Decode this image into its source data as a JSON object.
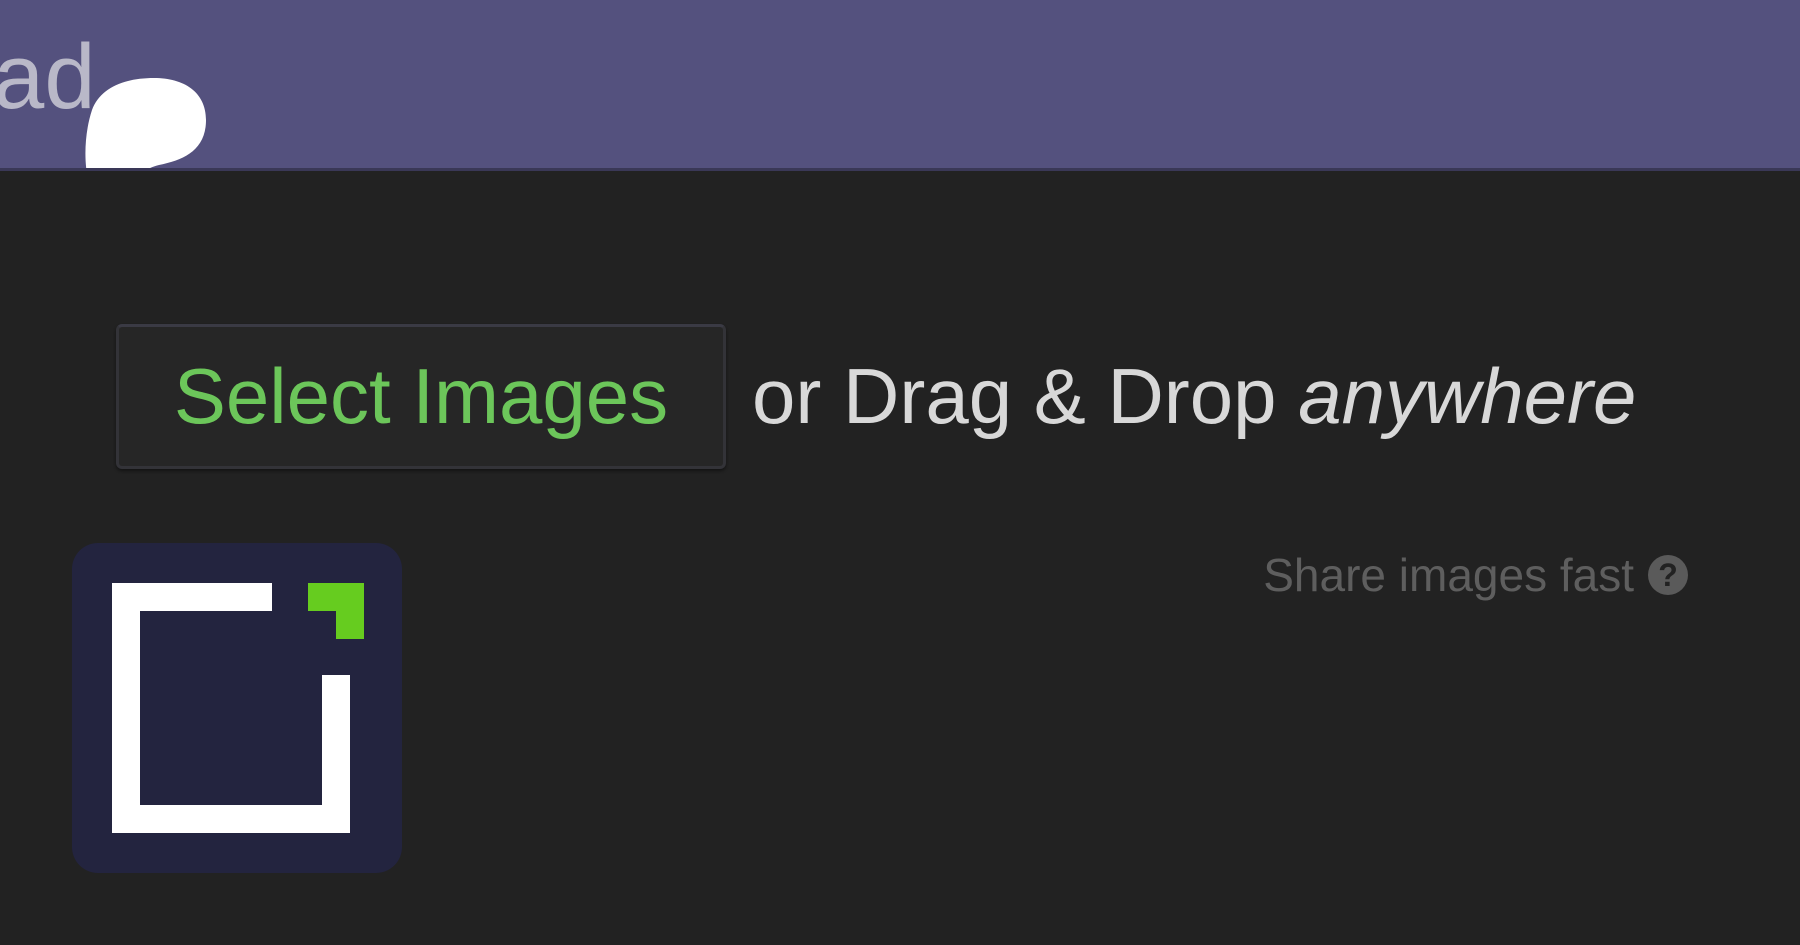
{
  "header": {
    "title_fragment": "oad"
  },
  "upload": {
    "select_button_label": "Select Images",
    "drag_text": "or Drag & Drop ",
    "drag_emphasis": "anywhere"
  },
  "tagline": {
    "text": "Share images fast",
    "help_icon": "?"
  },
  "icons": {
    "logo": "bracket-logo-icon",
    "help": "question-circle-icon",
    "cursor": "pointer-blob-icon"
  },
  "colors": {
    "header_bg": "#54517e",
    "page_bg": "#222222",
    "accent_green": "#6cc65a",
    "logo_bg": "#23243f"
  }
}
